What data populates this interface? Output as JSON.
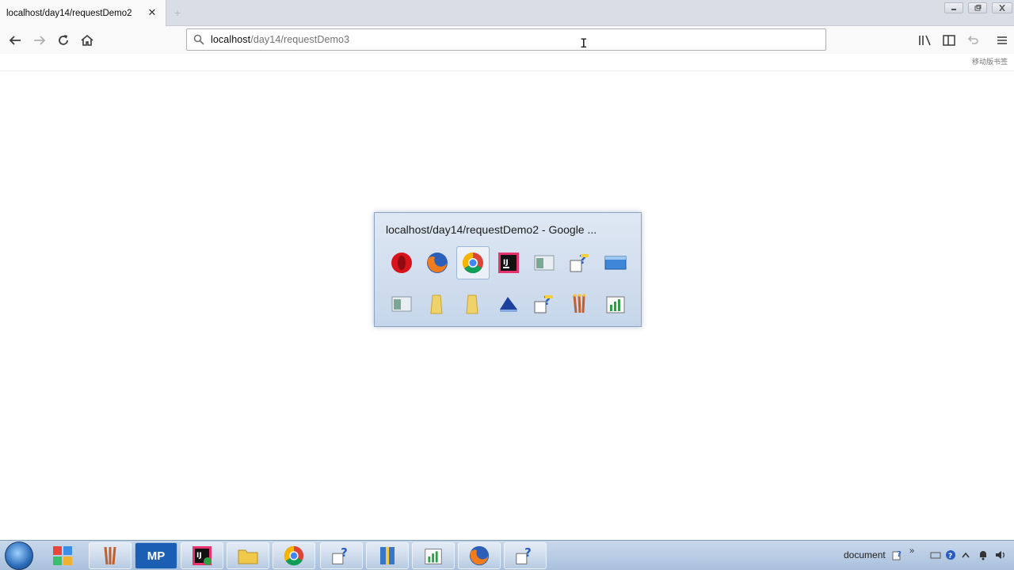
{
  "browser": {
    "tab": {
      "title": "localhost/day14/requestDemo2",
      "close_glyph": "✕"
    },
    "urlbar": {
      "host": "localhost",
      "path": "/day14/requestDemo3"
    },
    "bookmark_hint": "移动版书签"
  },
  "switcher": {
    "title": "localhost/day14/requestDemo2 - Google ...",
    "row1": [
      "opera-icon",
      "firefox-icon",
      "chrome-icon",
      "intellij-icon",
      "window-icon",
      "help-icon",
      "desktop-icon"
    ],
    "row2": [
      "window-icon",
      "folder-icon",
      "folder-icon",
      "network-icon",
      "help-icon",
      "paint-icon",
      "notepad-chart-icon"
    ],
    "selected": "chrome-icon"
  },
  "taskbar": {
    "mp_label": "MP",
    "tray_text": "document",
    "chevron": "»"
  },
  "colors": {
    "accent": "#0a84ff",
    "taskbar": "#b5c9e2",
    "switcher_bg": "#d3e0f0"
  }
}
